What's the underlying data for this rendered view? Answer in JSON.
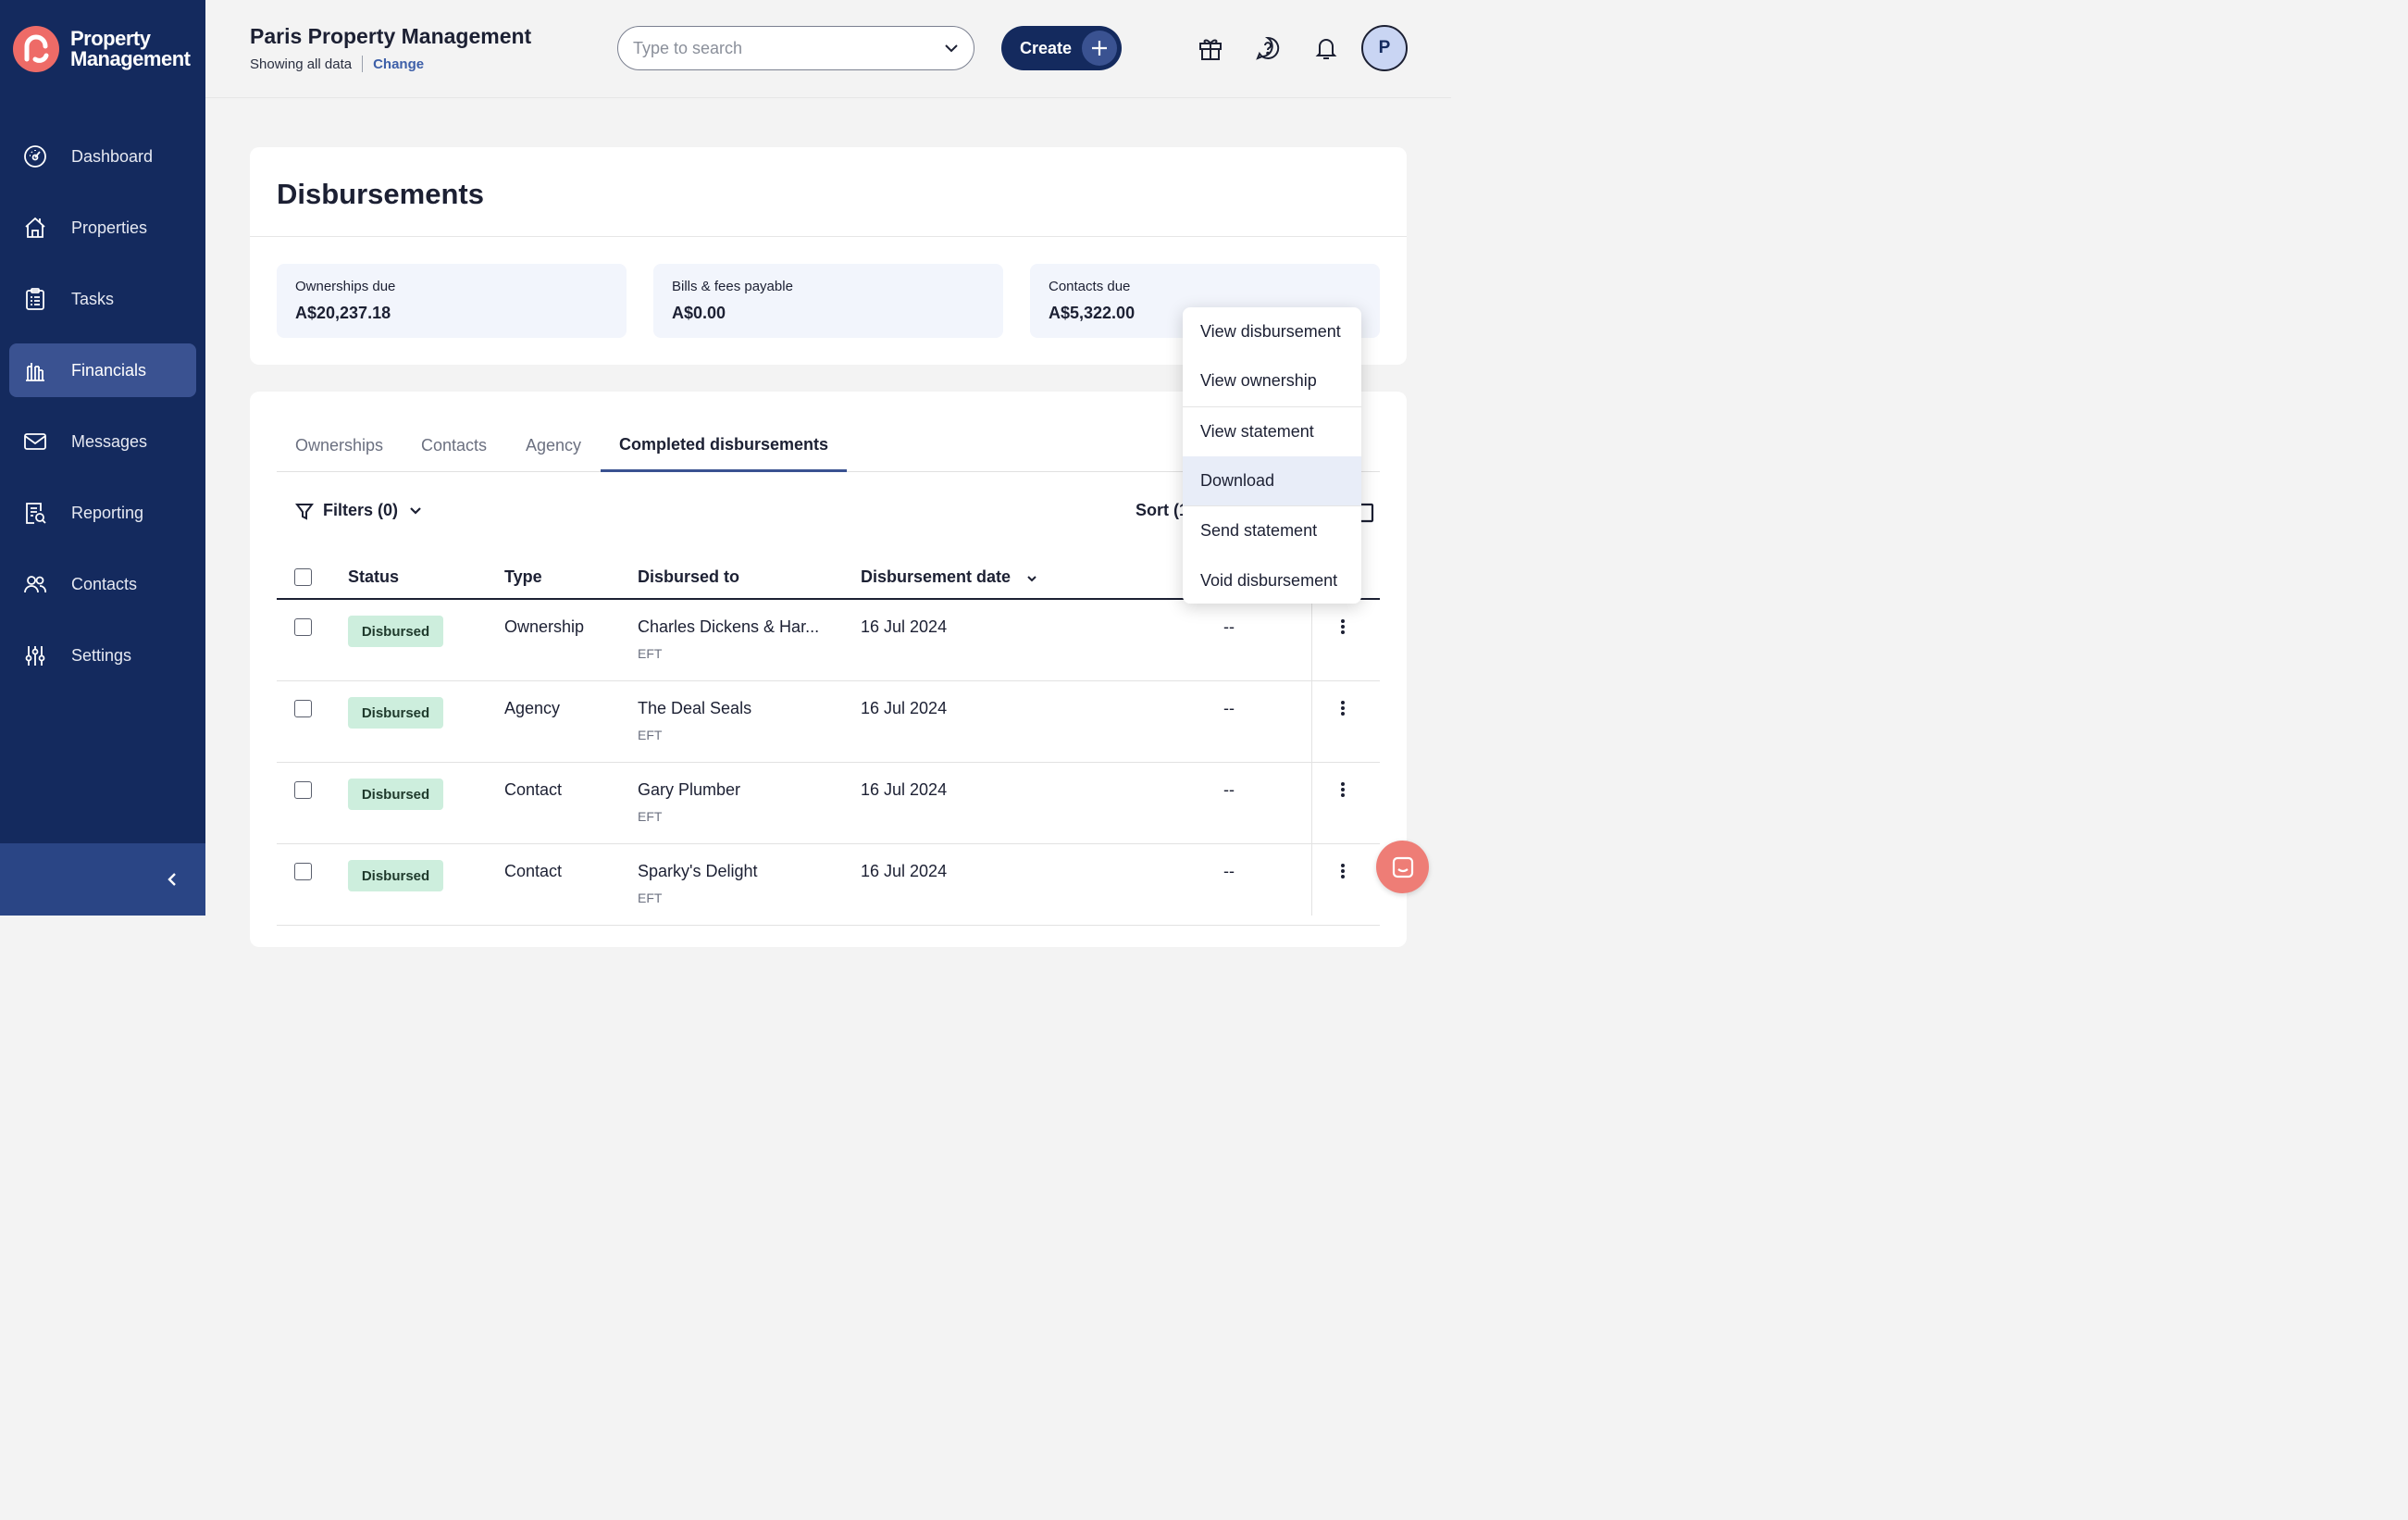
{
  "brand": {
    "line1": "Property",
    "line2": "Management"
  },
  "sidebar": {
    "items": [
      {
        "label": "Dashboard",
        "icon": "dashboard-icon"
      },
      {
        "label": "Properties",
        "icon": "home-icon"
      },
      {
        "label": "Tasks",
        "icon": "clipboard-icon"
      },
      {
        "label": "Financials",
        "icon": "bank-icon",
        "active": true
      },
      {
        "label": "Messages",
        "icon": "envelope-icon"
      },
      {
        "label": "Reporting",
        "icon": "report-icon"
      },
      {
        "label": "Contacts",
        "icon": "people-icon"
      },
      {
        "label": "Settings",
        "icon": "sliders-icon"
      }
    ]
  },
  "header": {
    "org_name": "Paris Property Management",
    "showing": "Showing all data",
    "change": "Change",
    "search_placeholder": "Type to search",
    "create": "Create",
    "avatar_initial": "P"
  },
  "page": {
    "title": "Disbursements",
    "stats": [
      {
        "label": "Ownerships due",
        "value": "A$20,237.18"
      },
      {
        "label": "Bills & fees payable",
        "value": "A$0.00"
      },
      {
        "label": "Contacts due",
        "value": "A$5,322.00"
      }
    ],
    "tabs": [
      "Ownerships",
      "Contacts",
      "Agency",
      "Completed disbursements"
    ],
    "active_tab": "Completed disbursements",
    "filters": "Filters (0)",
    "sort": "Sort (1"
  },
  "table": {
    "headers": {
      "status": "Status",
      "type": "Type",
      "disbursed_to": "Disbursed to",
      "date": "Disbursement date"
    },
    "rows": [
      {
        "status": "Disbursed",
        "type": "Ownership",
        "to": "Charles Dickens & Har...",
        "method": "EFT",
        "date": "16 Jul 2024",
        "extra": "--"
      },
      {
        "status": "Disbursed",
        "type": "Agency",
        "to": "The Deal Seals",
        "method": "EFT",
        "date": "16 Jul 2024",
        "extra": "--"
      },
      {
        "status": "Disbursed",
        "type": "Contact",
        "to": "Gary Plumber",
        "method": "EFT",
        "date": "16 Jul 2024",
        "extra": "--"
      },
      {
        "status": "Disbursed",
        "type": "Contact",
        "to": "Sparky's Delight",
        "method": "EFT",
        "date": "16 Jul 2024",
        "extra": "--"
      }
    ]
  },
  "menu": {
    "items": [
      "View disbursement",
      "View ownership",
      "View statement",
      "Download",
      "Send statement",
      "Void disbursement"
    ],
    "highlighted": "Download"
  },
  "colors": {
    "sidebar": "#142a5e",
    "sidebar_active": "#3a5291",
    "accent": "#3d5fa8",
    "badge_bg": "#cdeedd",
    "brand_logo": "#ee6b67"
  }
}
